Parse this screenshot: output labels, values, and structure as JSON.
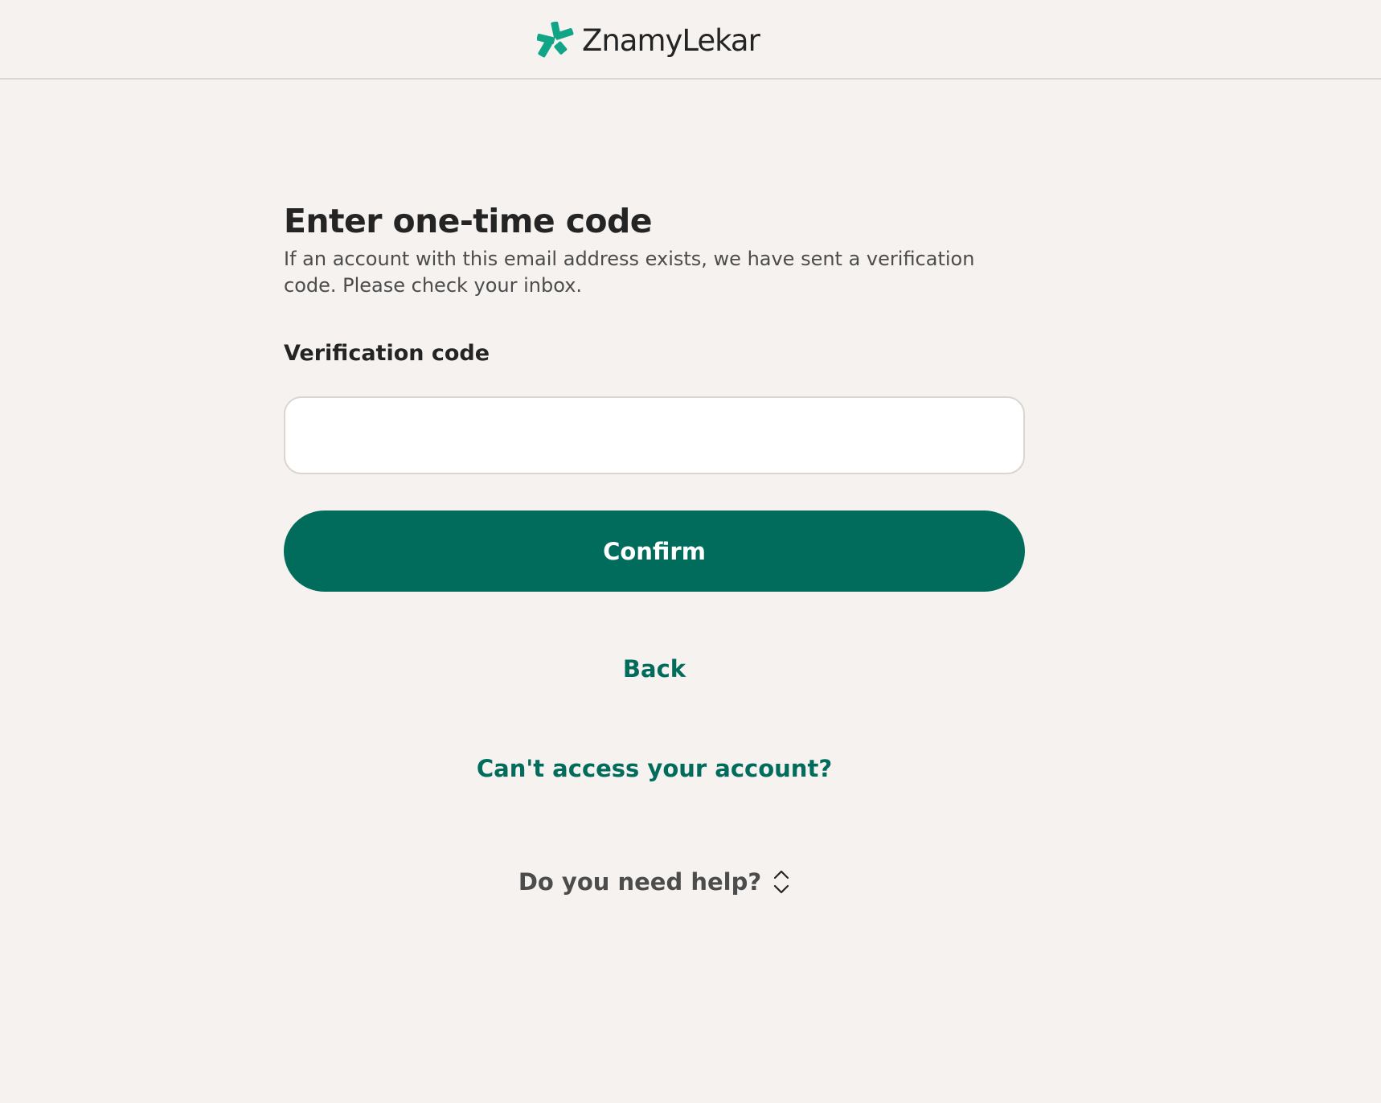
{
  "header": {
    "brand_name": "ZnamyLekar",
    "brand_color": "#11a587",
    "logo_icon": "znamylekar-logo-icon"
  },
  "main": {
    "title": "Enter one-time code",
    "subtitle": "If an account with this email address exists, we have sent a verification code. Please check your inbox.",
    "verification_label": "Verification code",
    "verification_value": "",
    "verification_placeholder": "",
    "confirm_label": "Confirm",
    "back_label": "Back",
    "cant_access_label": "Can't access your account?",
    "help_label": "Do you need help?",
    "help_icon": "chevron-up-down-icon"
  },
  "colors": {
    "background": "#f5f2ef",
    "primary": "#016b5c",
    "text": "#242424",
    "muted_text": "#4c4c4c",
    "border": "#dad5d1"
  }
}
